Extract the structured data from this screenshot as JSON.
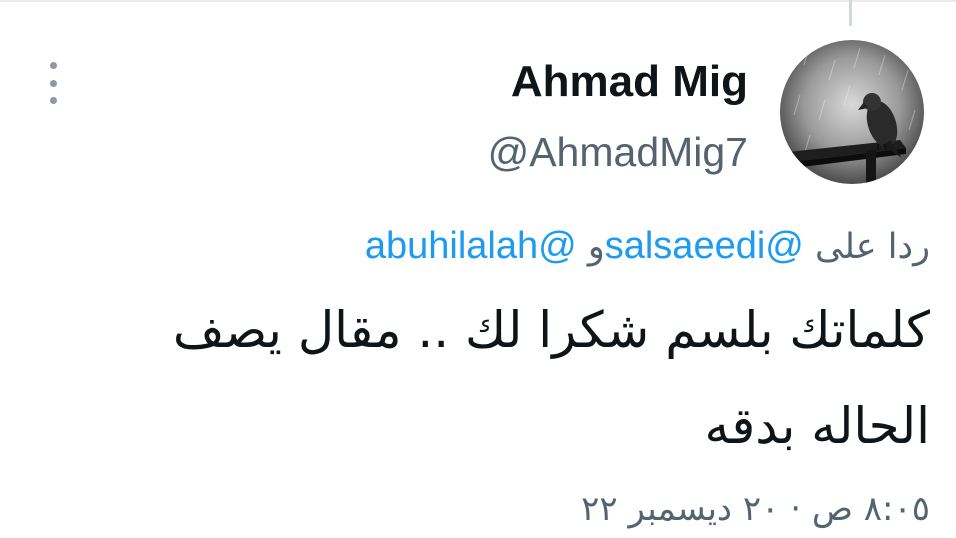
{
  "tweet": {
    "author": {
      "display_name": "Ahmad Mig",
      "handle": "@AhmadMig7",
      "avatar_icon": "avatar-bird-in-rain"
    },
    "menu_icon": "more-vertical-icon",
    "reply": {
      "prefix": "ردا على",
      "mention_1": "@salsaeedi",
      "connector": "و",
      "mention_2": "@abuhilalah"
    },
    "text": "كلماتك بلسم شكرا لك .. مقال يصف الحاله بدقه",
    "timestamp": "٨:٠٥ ص · ٢٠ ديسمبر ٢٢"
  },
  "colors": {
    "text_primary": "#0f1419",
    "text_secondary": "#536471",
    "link": "#1d9bf0",
    "divider": "#e6ecf0"
  }
}
